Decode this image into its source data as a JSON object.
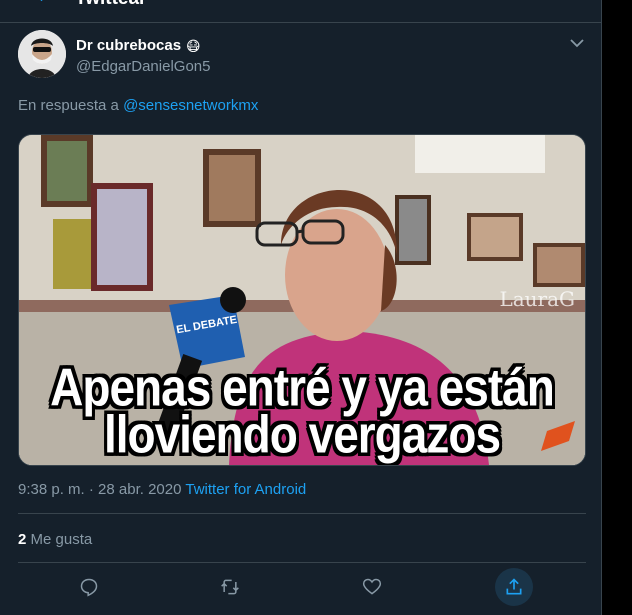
{
  "header": {
    "title": "Twittear"
  },
  "tweet": {
    "author_name": "Dr cubrebocas",
    "author_emoji": "😷",
    "author_handle": "@EdgarDanielGon5",
    "reply_prefix": "En respuesta a",
    "reply_to": "@sensesnetworkmx",
    "media": {
      "caption_line1": "Apenas entré y ya están",
      "caption_line2": "lloviendo vergazos",
      "watermark": "LauraG",
      "mic_label": "EL DEBATE"
    },
    "timestamp": "9:38 p. m. · 28 abr. 2020",
    "source": "Twitter for Android",
    "likes_count": "2",
    "likes_label": "Me gusta"
  },
  "actions": {
    "reply_icon": "reply-icon",
    "retweet_icon": "retweet-icon",
    "like_icon": "heart-icon",
    "share_icon": "share-icon"
  },
  "colors": {
    "background": "#15202b",
    "accent": "#1da1f2",
    "secondary_text": "#8899a6",
    "border": "#38444d"
  }
}
